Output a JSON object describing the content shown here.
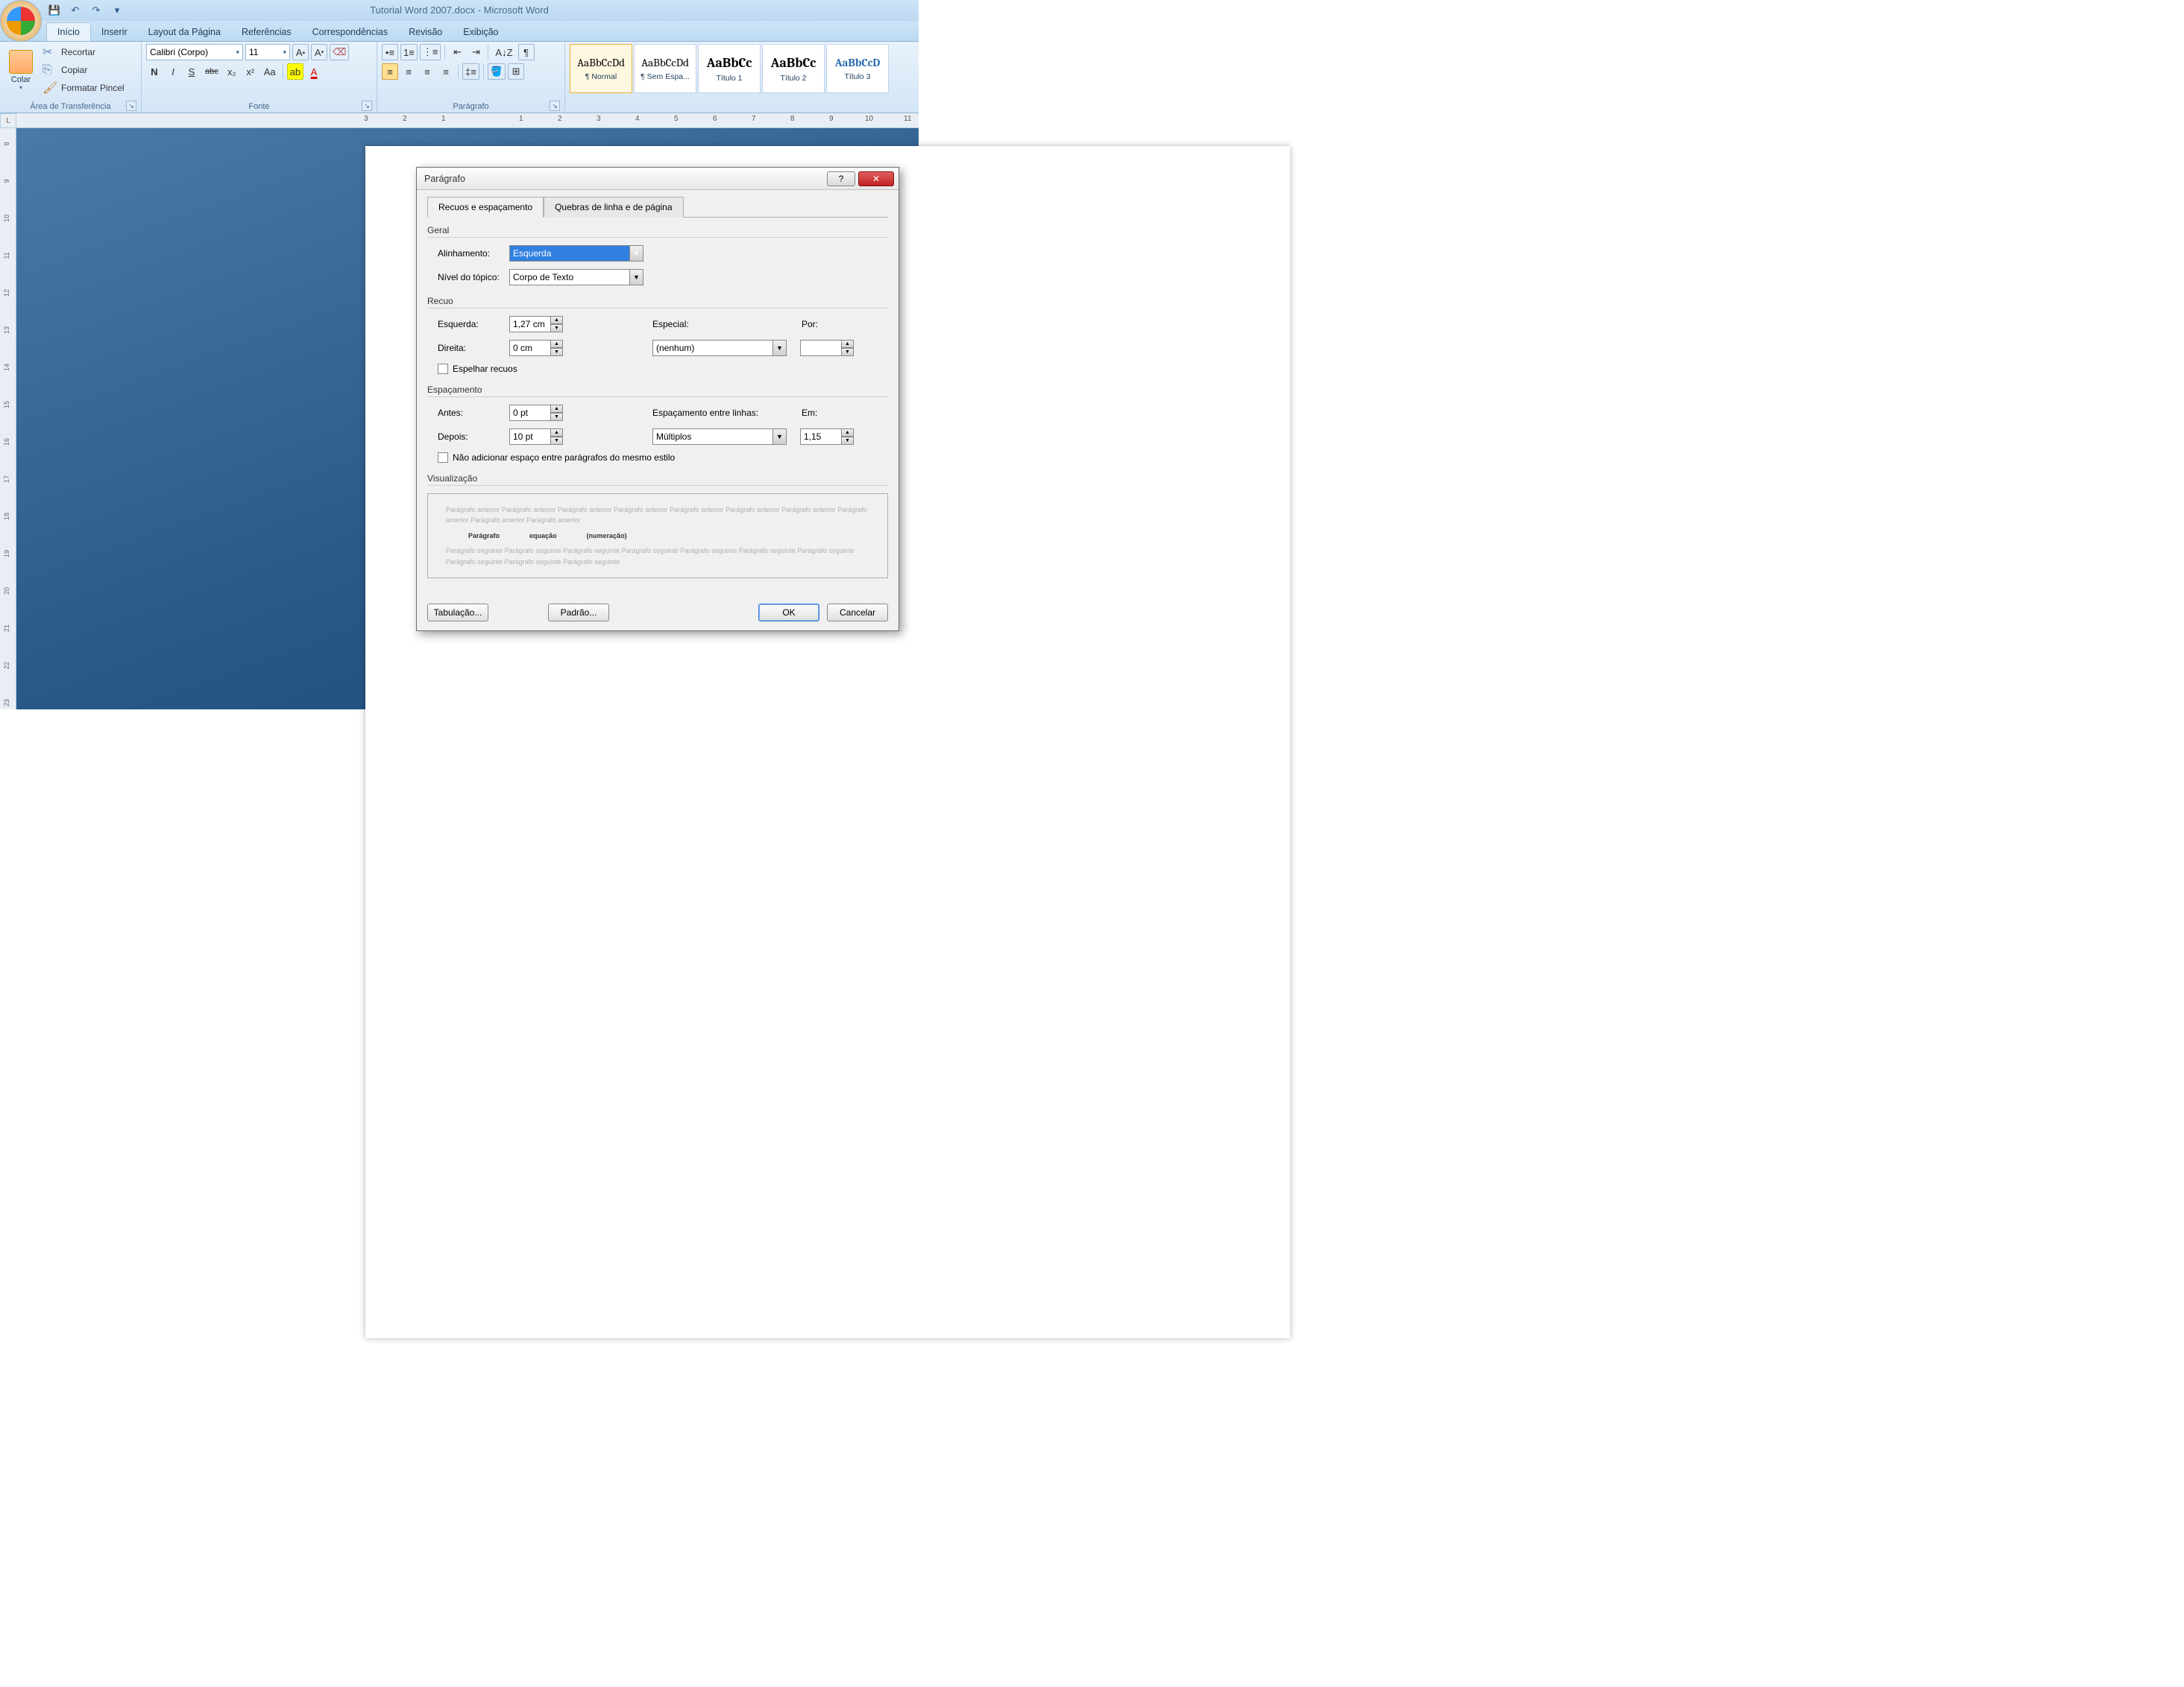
{
  "titlebar": {
    "doc_title": "Tutorial Word 2007.docx - Microsoft Word"
  },
  "qat": {
    "save": "💾",
    "undo": "↶",
    "redo": "↷"
  },
  "tabs": {
    "items": [
      "Início",
      "Inserir",
      "Layout da Página",
      "Referências",
      "Correspondências",
      "Revisão",
      "Exibição"
    ],
    "active_index": 0
  },
  "ribbon": {
    "clipboard": {
      "label": "Área de Transferência",
      "paste": "Colar",
      "cut": "Recortar",
      "copy": "Copiar",
      "format_painter": "Formatar Pincel"
    },
    "font": {
      "label": "Fonte",
      "name": "Calibri (Corpo)",
      "size": "11",
      "bold": "N",
      "italic": "I",
      "underline": "S",
      "strike": "abc",
      "sub": "x₂",
      "sup": "x²",
      "case": "Aa",
      "highlight": "ab",
      "color": "A"
    },
    "paragraph": {
      "label": "Parágrafo"
    },
    "styles": {
      "items": [
        {
          "preview": "AaBbCcDd",
          "name": "¶ Normal",
          "selected": true
        },
        {
          "preview": "AaBbCcDd",
          "name": "¶ Sem Espa..."
        },
        {
          "preview": "AaBbCc",
          "name": "Título 1",
          "serif": true
        },
        {
          "preview": "AaBbCc",
          "name": "Título 2",
          "serif": true
        },
        {
          "preview": "AaBbCcD",
          "name": "Título 3",
          "blue": true
        }
      ]
    }
  },
  "ruler": {
    "h": [
      "3",
      "2",
      "1",
      "",
      "1",
      "2",
      "3",
      "4",
      "5",
      "6",
      "7",
      "8",
      "9",
      "10",
      "11"
    ],
    "v": [
      "8",
      "9",
      "10",
      "11",
      "12",
      "13",
      "14",
      "15",
      "16",
      "17",
      "18",
      "19",
      "20",
      "21",
      "22",
      "23"
    ]
  },
  "dialog": {
    "title": "Parágrafo",
    "tab1": "Recuos e espaçamento",
    "tab2": "Quebras de linha e de página",
    "section_general": "Geral",
    "lbl_align": "Alinhamento:",
    "val_align": "Esquerda",
    "lbl_outline": "Nível do tópico:",
    "val_outline": "Corpo de Texto",
    "section_indent": "Recuo",
    "lbl_left": "Esquerda:",
    "val_left": "1,27 cm",
    "lbl_right": "Direita:",
    "val_right": "0 cm",
    "lbl_special": "Especial:",
    "val_special": "(nenhum)",
    "lbl_by": "Por:",
    "val_by": "",
    "chk_mirror": "Espelhar recuos",
    "section_spacing": "Espaçamento",
    "lbl_before": "Antes:",
    "val_before": "0 pt",
    "lbl_after": "Depois:",
    "val_after": "10 pt",
    "lbl_linesp": "Espaçamento entre linhas:",
    "val_linesp": "Múltiplos",
    "lbl_at": "Em:",
    "val_at": "1,15",
    "chk_nospace": "Não adicionar espaço entre parágrafos do mesmo estilo",
    "section_preview": "Visualização",
    "prev_before": "Parágrafo anterior Parágrafo anterior Parágrafo anterior Parágrafo anterior Parágrafo anterior Parágrafo anterior Parágrafo anterior Parágrafo anterior Parágrafo anterior Parágrafo anterior",
    "prev_cur_1": "Parágrafo",
    "prev_cur_2": "equação",
    "prev_cur_3": "(numeração)",
    "prev_after": "Parágrafo seguinte Parágrafo seguinte Parágrafo seguinte Parágrafo seguinte Parágrafo seguinte Parágrafo seguinte Parágrafo seguinte Parágrafo seguinte Parágrafo seguinte Parágrafo seguinte",
    "btn_tabs": "Tabulação...",
    "btn_default": "Padrão...",
    "btn_ok": "OK",
    "btn_cancel": "Cancelar"
  }
}
